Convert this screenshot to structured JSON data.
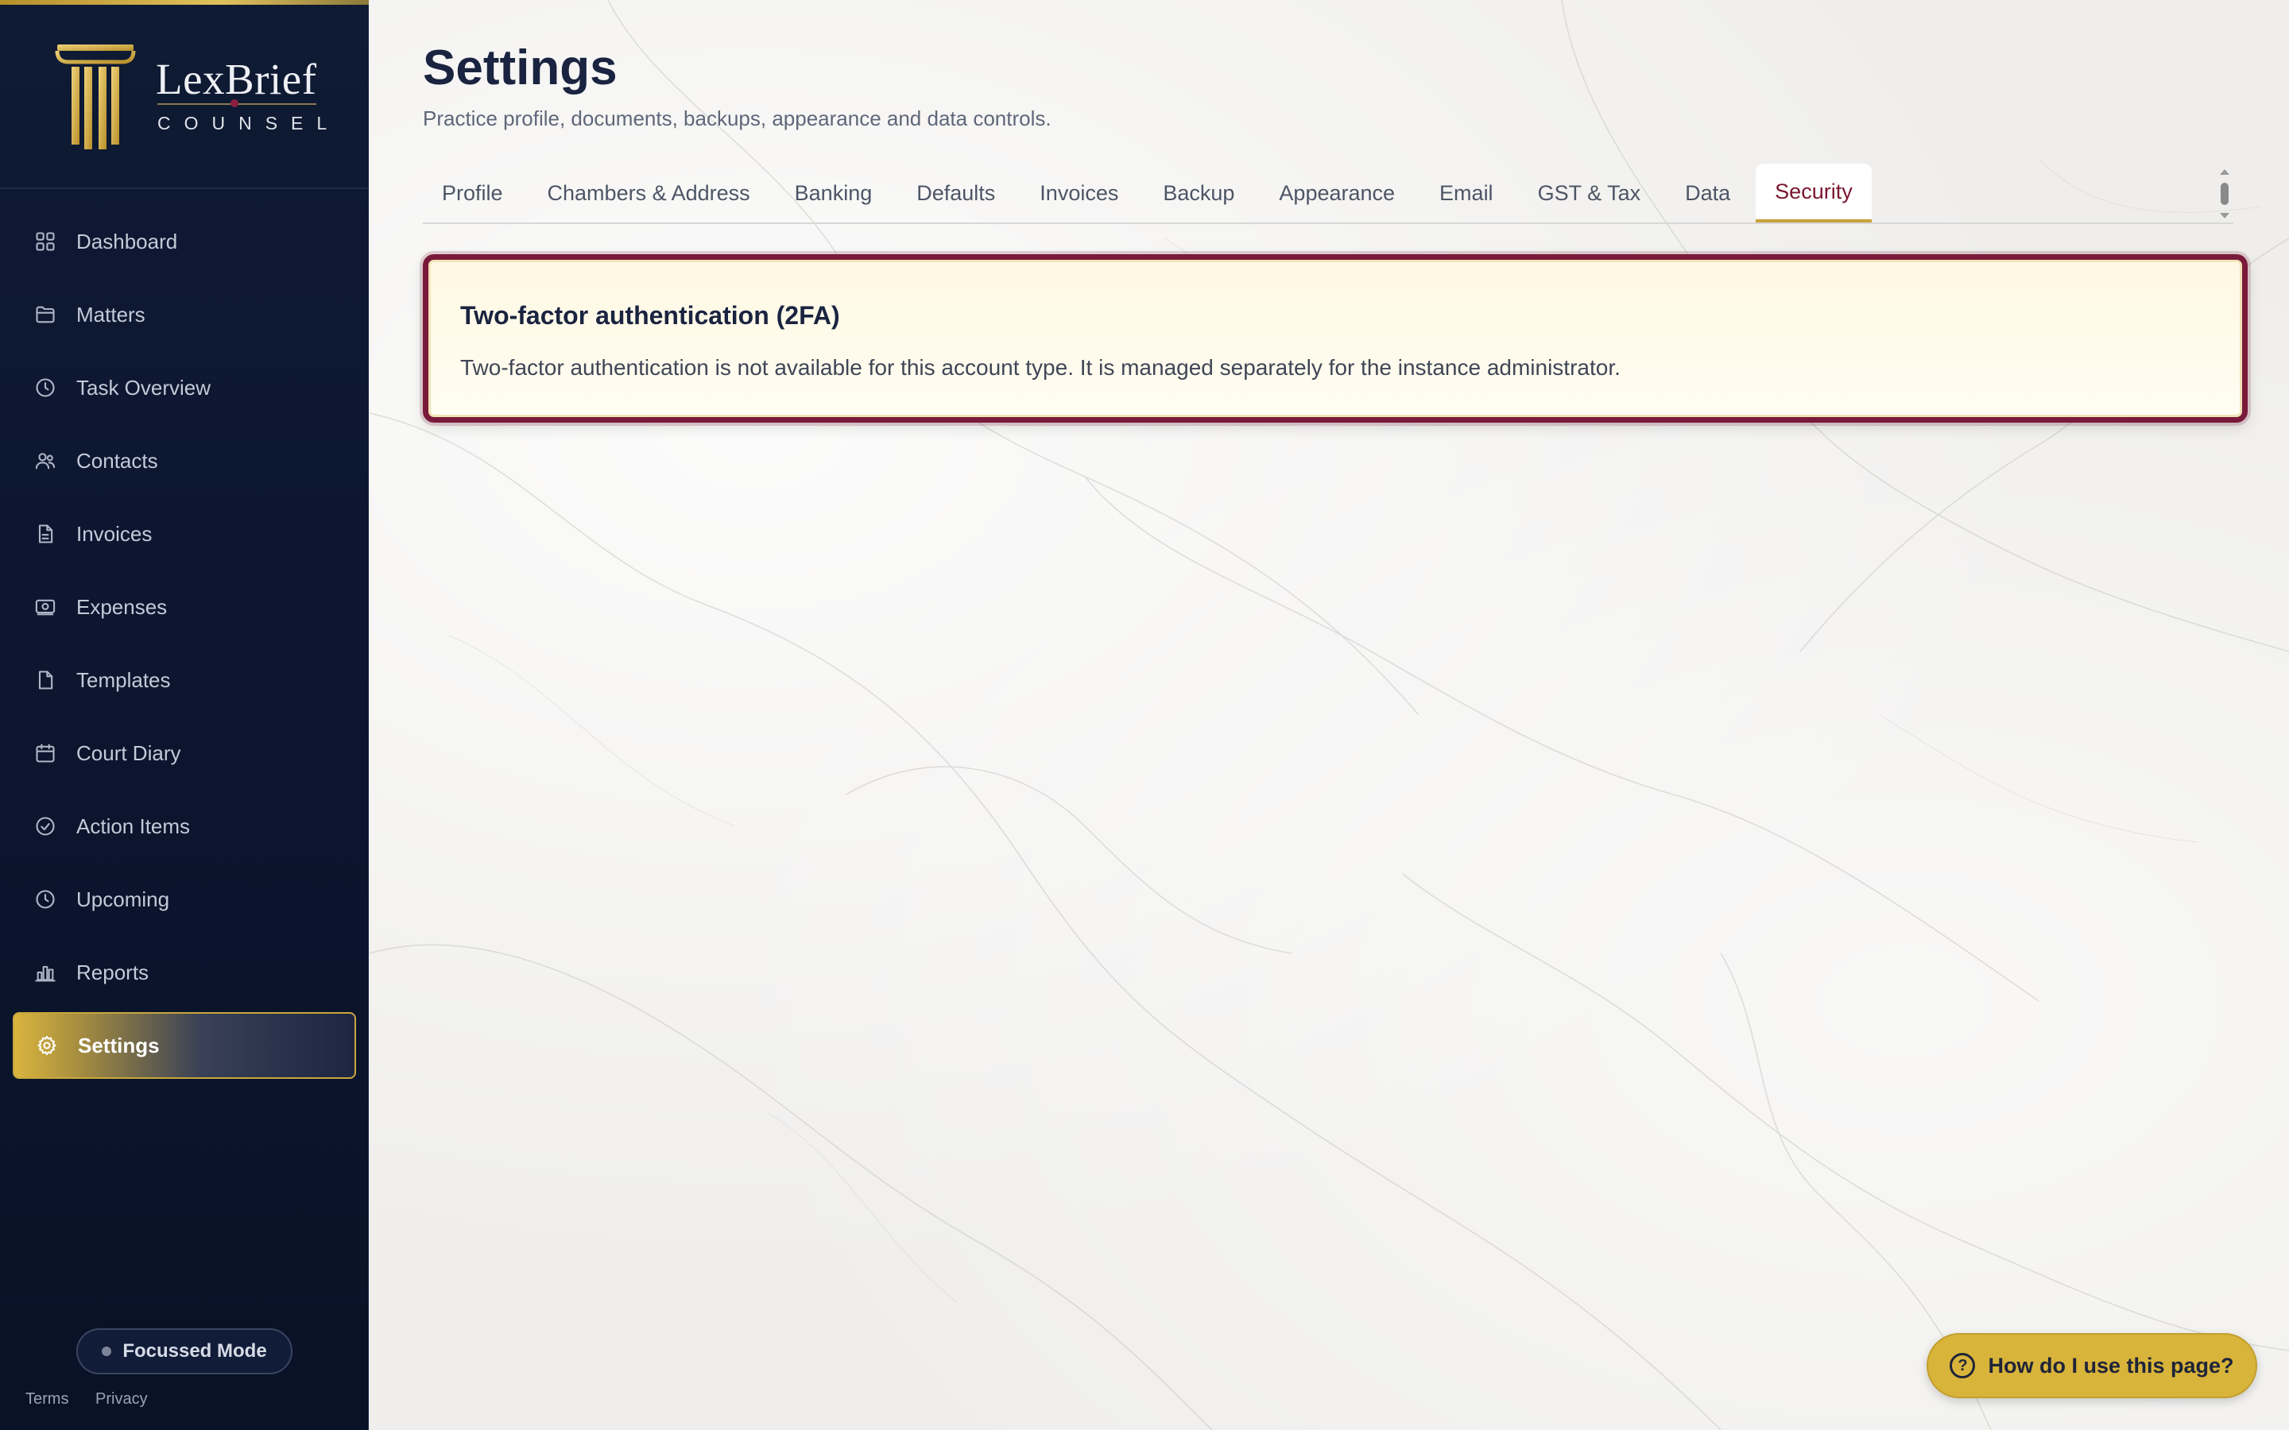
{
  "brand": {
    "name": "LexBrief",
    "subtitle": "COUNSEL"
  },
  "sidebar": {
    "items": [
      {
        "label": "Dashboard",
        "icon": "grid-icon"
      },
      {
        "label": "Matters",
        "icon": "folder-icon"
      },
      {
        "label": "Task Overview",
        "icon": "clock-icon"
      },
      {
        "label": "Contacts",
        "icon": "users-icon"
      },
      {
        "label": "Invoices",
        "icon": "file-text-icon"
      },
      {
        "label": "Expenses",
        "icon": "banknote-icon"
      },
      {
        "label": "Templates",
        "icon": "file-icon"
      },
      {
        "label": "Court Diary",
        "icon": "calendar-icon"
      },
      {
        "label": "Action Items",
        "icon": "check-circle-icon"
      },
      {
        "label": "Upcoming",
        "icon": "clock-icon"
      },
      {
        "label": "Reports",
        "icon": "bar-chart-icon"
      },
      {
        "label": "Settings",
        "icon": "gear-icon",
        "active": true
      }
    ],
    "focus_mode_label": "Focussed Mode",
    "footer": {
      "terms": "Terms",
      "privacy": "Privacy"
    }
  },
  "page": {
    "title": "Settings",
    "subtitle": "Practice profile, documents, backups, appearance and data controls."
  },
  "tabs": [
    {
      "label": "Profile"
    },
    {
      "label": "Chambers & Address"
    },
    {
      "label": "Banking"
    },
    {
      "label": "Defaults"
    },
    {
      "label": "Invoices"
    },
    {
      "label": "Backup"
    },
    {
      "label": "Appearance"
    },
    {
      "label": "Email"
    },
    {
      "label": "GST & Tax"
    },
    {
      "label": "Data"
    },
    {
      "label": "Security",
      "active": true
    }
  ],
  "security_card": {
    "title": "Two-factor authentication (2FA)",
    "text": "Two-factor authentication is not available for this account type. It is managed separately for the instance administrator."
  },
  "help_button": {
    "label": "How do I use this page?",
    "icon": "question-circle-icon"
  },
  "colors": {
    "sidebar_bg": "#0c1630",
    "accent_gold": "#d9b43a",
    "accent_maroon": "#7a1a3a",
    "title_navy": "#1a2440"
  }
}
